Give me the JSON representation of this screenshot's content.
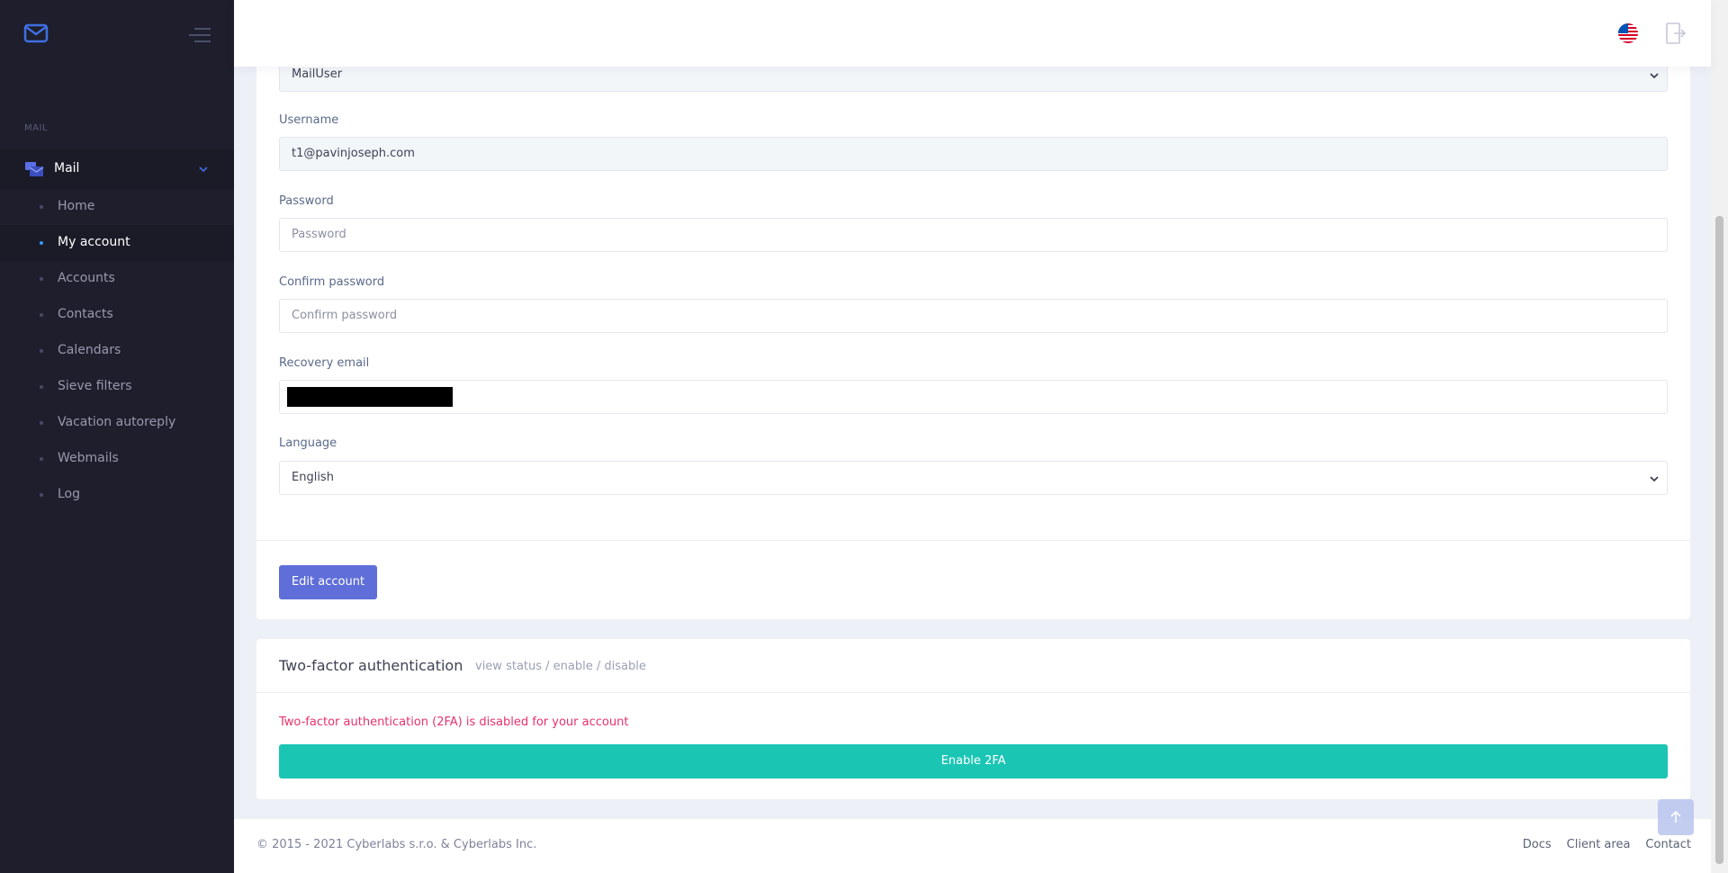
{
  "sidebar": {
    "section_label": "MAIL",
    "mail_label": "Mail",
    "items": [
      {
        "label": "Home"
      },
      {
        "label": "My account"
      },
      {
        "label": "Accounts"
      },
      {
        "label": "Contacts"
      },
      {
        "label": "Calendars"
      },
      {
        "label": "Sieve filters"
      },
      {
        "label": "Vacation autoreply"
      },
      {
        "label": "Webmails"
      },
      {
        "label": "Log"
      }
    ],
    "active_item": "My account",
    "accent_color": "#3699ff"
  },
  "header": {
    "icons": [
      "us-flag-icon",
      "logout-icon"
    ]
  },
  "form": {
    "role_value": "MailUser",
    "username_label": "Username",
    "username_value": "t1@pavinjoseph.com",
    "password_label": "Password",
    "password_placeholder": "Password",
    "confirm_label": "Confirm password",
    "confirm_placeholder": "Confirm password",
    "recovery_label": "Recovery email",
    "language_label": "Language",
    "language_value": "English",
    "edit_button": "Edit account",
    "edit_button_color": "#5f6ed8"
  },
  "twofa": {
    "title": "Two-factor authentication",
    "subtitle": "view status / enable / disable",
    "warning": "Two-factor authentication (2FA) is disabled for your account",
    "warning_color": "#e5326b",
    "enable_button": "Enable 2FA",
    "enable_button_color": "#1bc5b4"
  },
  "footer": {
    "copyright": "© 2015 - 2021 Cyberlabs s.r.o. & Cyberlabs Inc.",
    "links": [
      "Docs",
      "Client area",
      "Contact"
    ]
  }
}
